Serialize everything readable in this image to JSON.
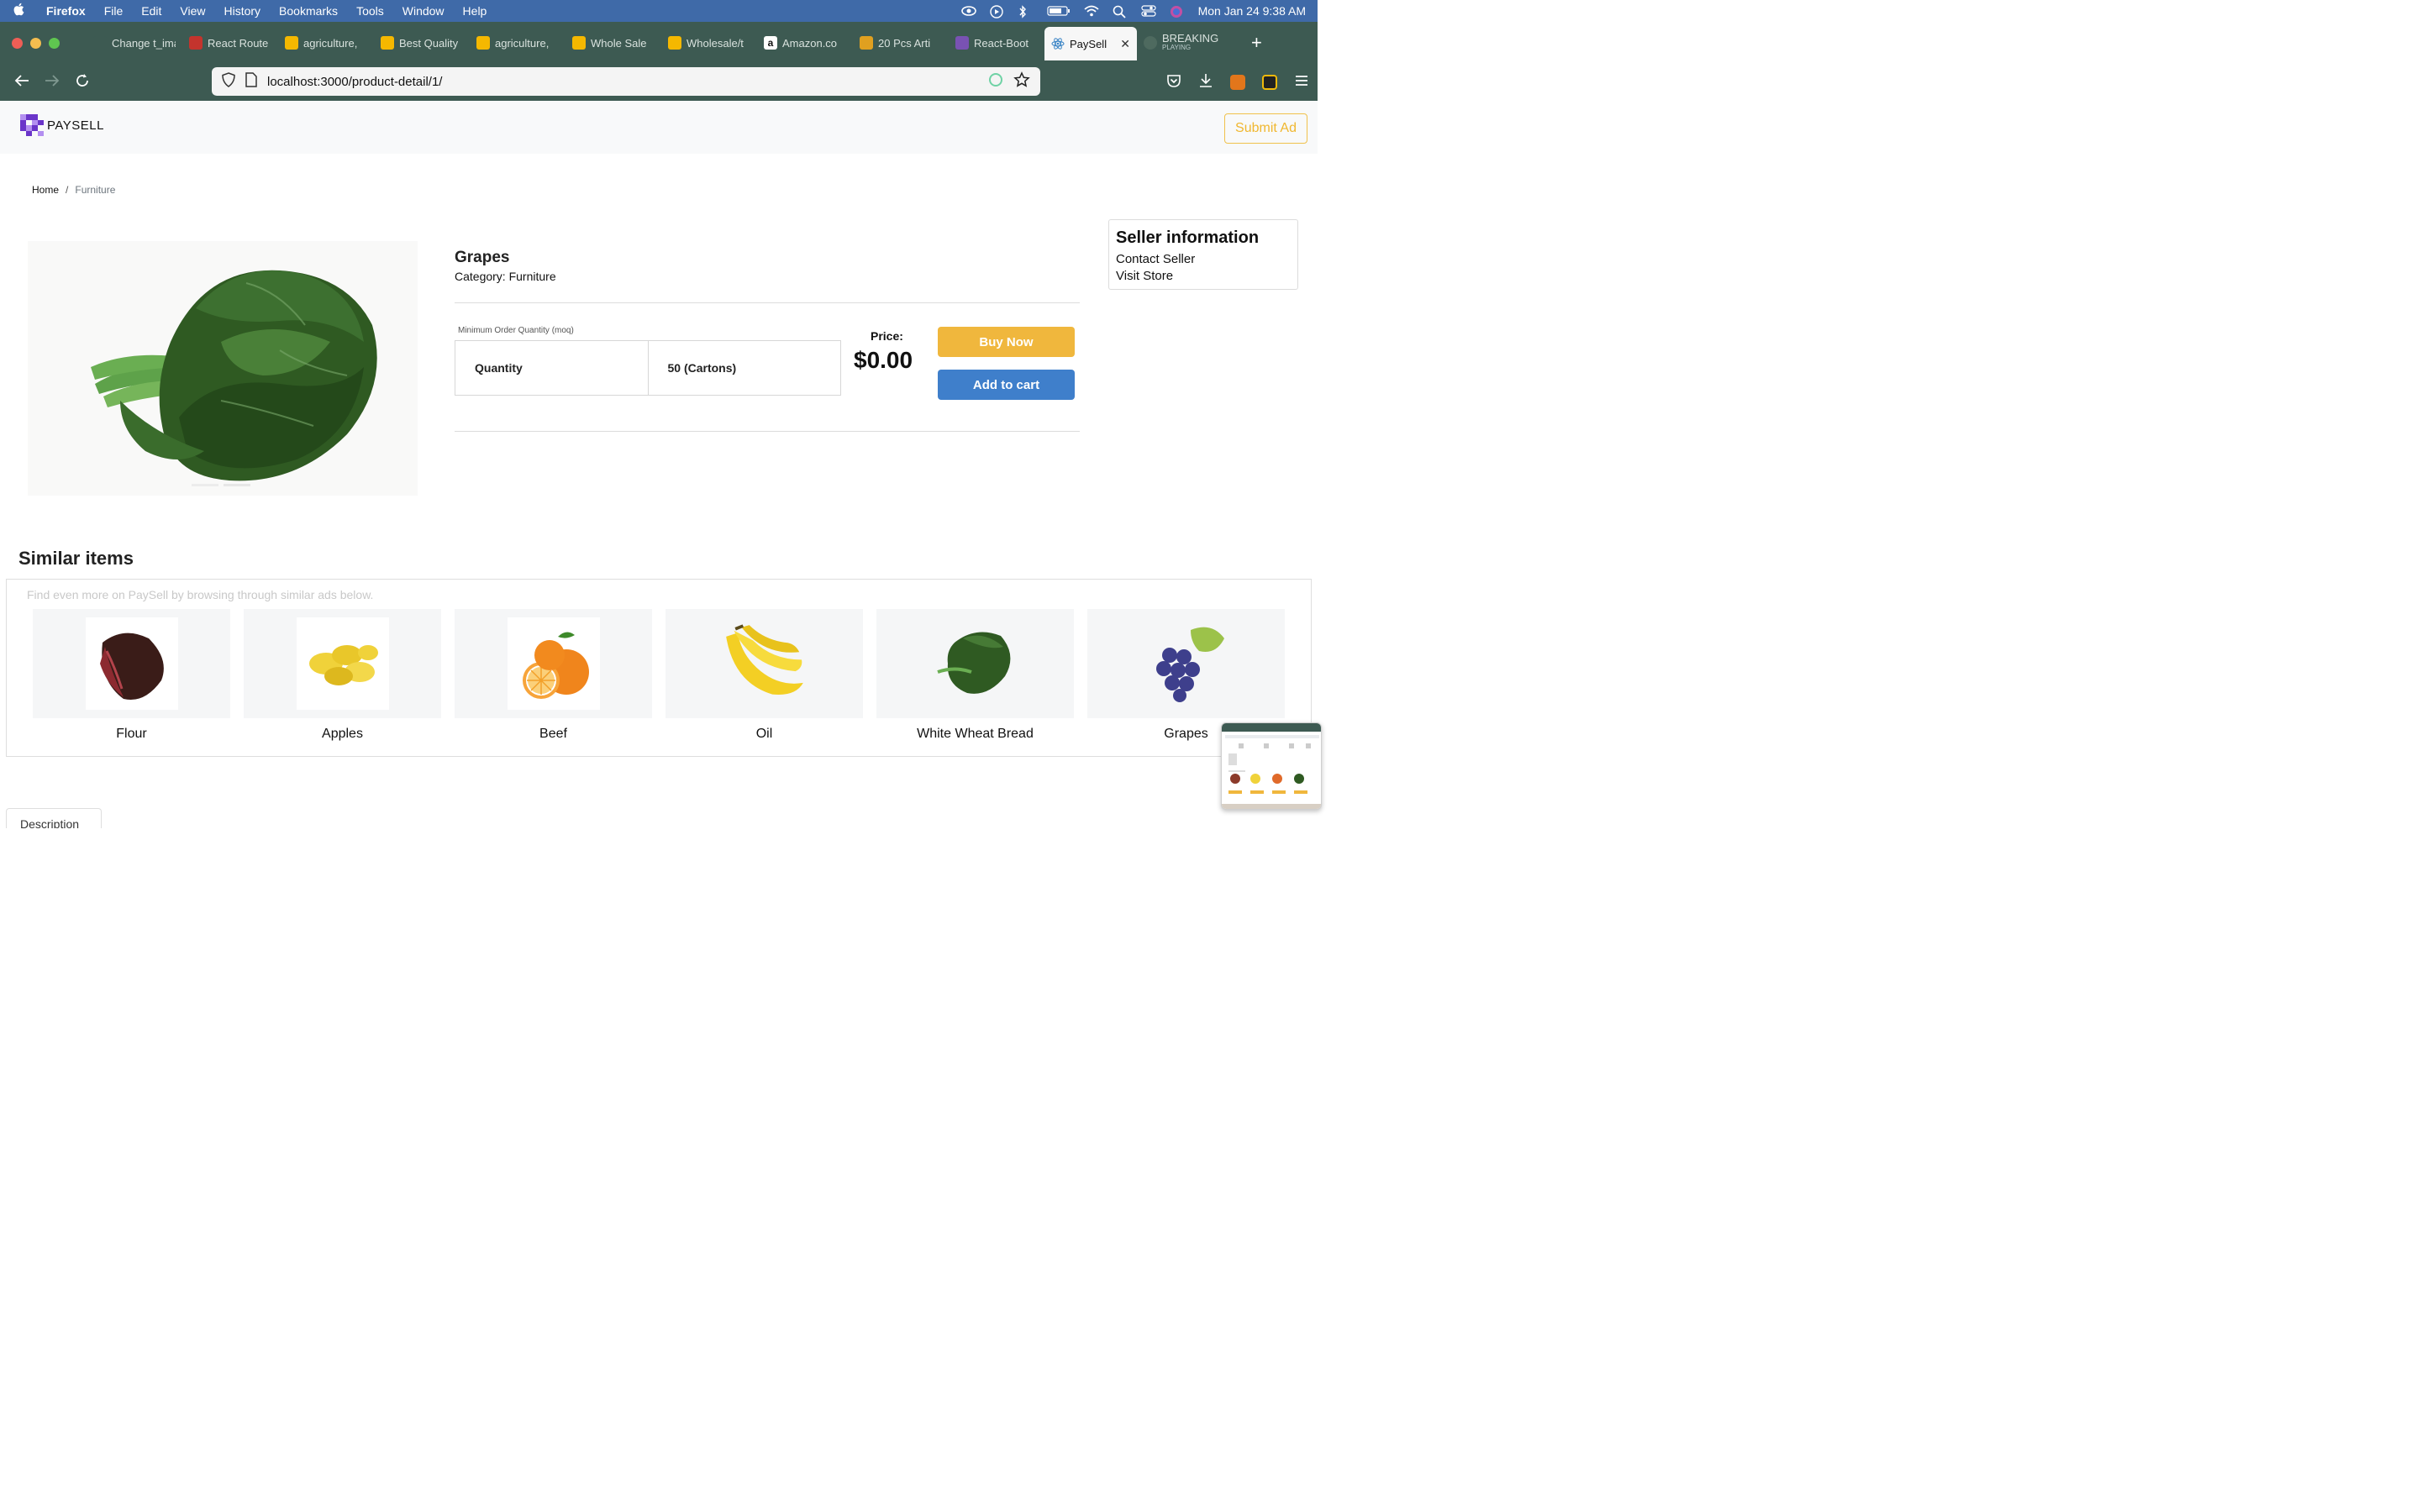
{
  "menubar": {
    "app": "Firefox",
    "items": [
      "File",
      "Edit",
      "View",
      "History",
      "Bookmarks",
      "Tools",
      "Window",
      "Help"
    ],
    "clock": "Mon Jan 24  9:38 AM"
  },
  "tabs": [
    {
      "label": "Change t_image",
      "favicon_color": "#3d5a52"
    },
    {
      "label": "React Route",
      "favicon_color": "#c4342d"
    },
    {
      "label": "agriculture,",
      "favicon_color": "#f5b800"
    },
    {
      "label": "Best Quality",
      "favicon_color": "#f5b800"
    },
    {
      "label": "agriculture,",
      "favicon_color": "#f5b800"
    },
    {
      "label": "Whole Sale",
      "favicon_color": "#f5b800"
    },
    {
      "label": "Wholesale/t",
      "favicon_color": "#f5b800"
    },
    {
      "label": "Amazon.co",
      "favicon_color": "#ffffff"
    },
    {
      "label": "20 Pcs Arti",
      "favicon_color": "#e0a020"
    },
    {
      "label": "React-Boot",
      "favicon_color": "#7952b3"
    }
  ],
  "active_tab": {
    "label": "PaySell",
    "close": "✕"
  },
  "playing_tab": {
    "label": "BREAKING",
    "sub": "PLAYING"
  },
  "url": "localhost:3000/product-detail/1/",
  "site": {
    "brand": "PAYSELL",
    "submit_ad": "Submit Ad",
    "accent": "#f0b73d",
    "cart_color": "#3f7fcb"
  },
  "breadcrumb": {
    "home": "Home",
    "sep": "/",
    "current": "Furniture"
  },
  "product": {
    "title": "Grapes",
    "category_label": "Category:",
    "category": "Furniture",
    "moq_caption": "Minimum Order Quantity (moq)",
    "moq_key": "Quantity",
    "moq_value": "50 (Cartons)",
    "price_label": "Price:",
    "price": "$0.00",
    "buy_now": "Buy Now",
    "add_to_cart": "Add to cart"
  },
  "seller": {
    "title": "Seller information",
    "contact": "Contact Seller",
    "store": "Visit Store"
  },
  "similar": {
    "title": "Similar items",
    "hint": "Find even more on PaySell by browsing through similar ads below.",
    "items": [
      {
        "name": "Flour",
        "icon": "dried-meat-icon"
      },
      {
        "name": "Apples",
        "icon": "jackfruit-icon"
      },
      {
        "name": "Beef",
        "icon": "oranges-icon"
      },
      {
        "name": "Oil",
        "icon": "bananas-icon"
      },
      {
        "name": "White Wheat Bread",
        "icon": "spinach-icon"
      },
      {
        "name": "Grapes",
        "icon": "grapes-icon"
      }
    ]
  },
  "description_tab": "Description"
}
